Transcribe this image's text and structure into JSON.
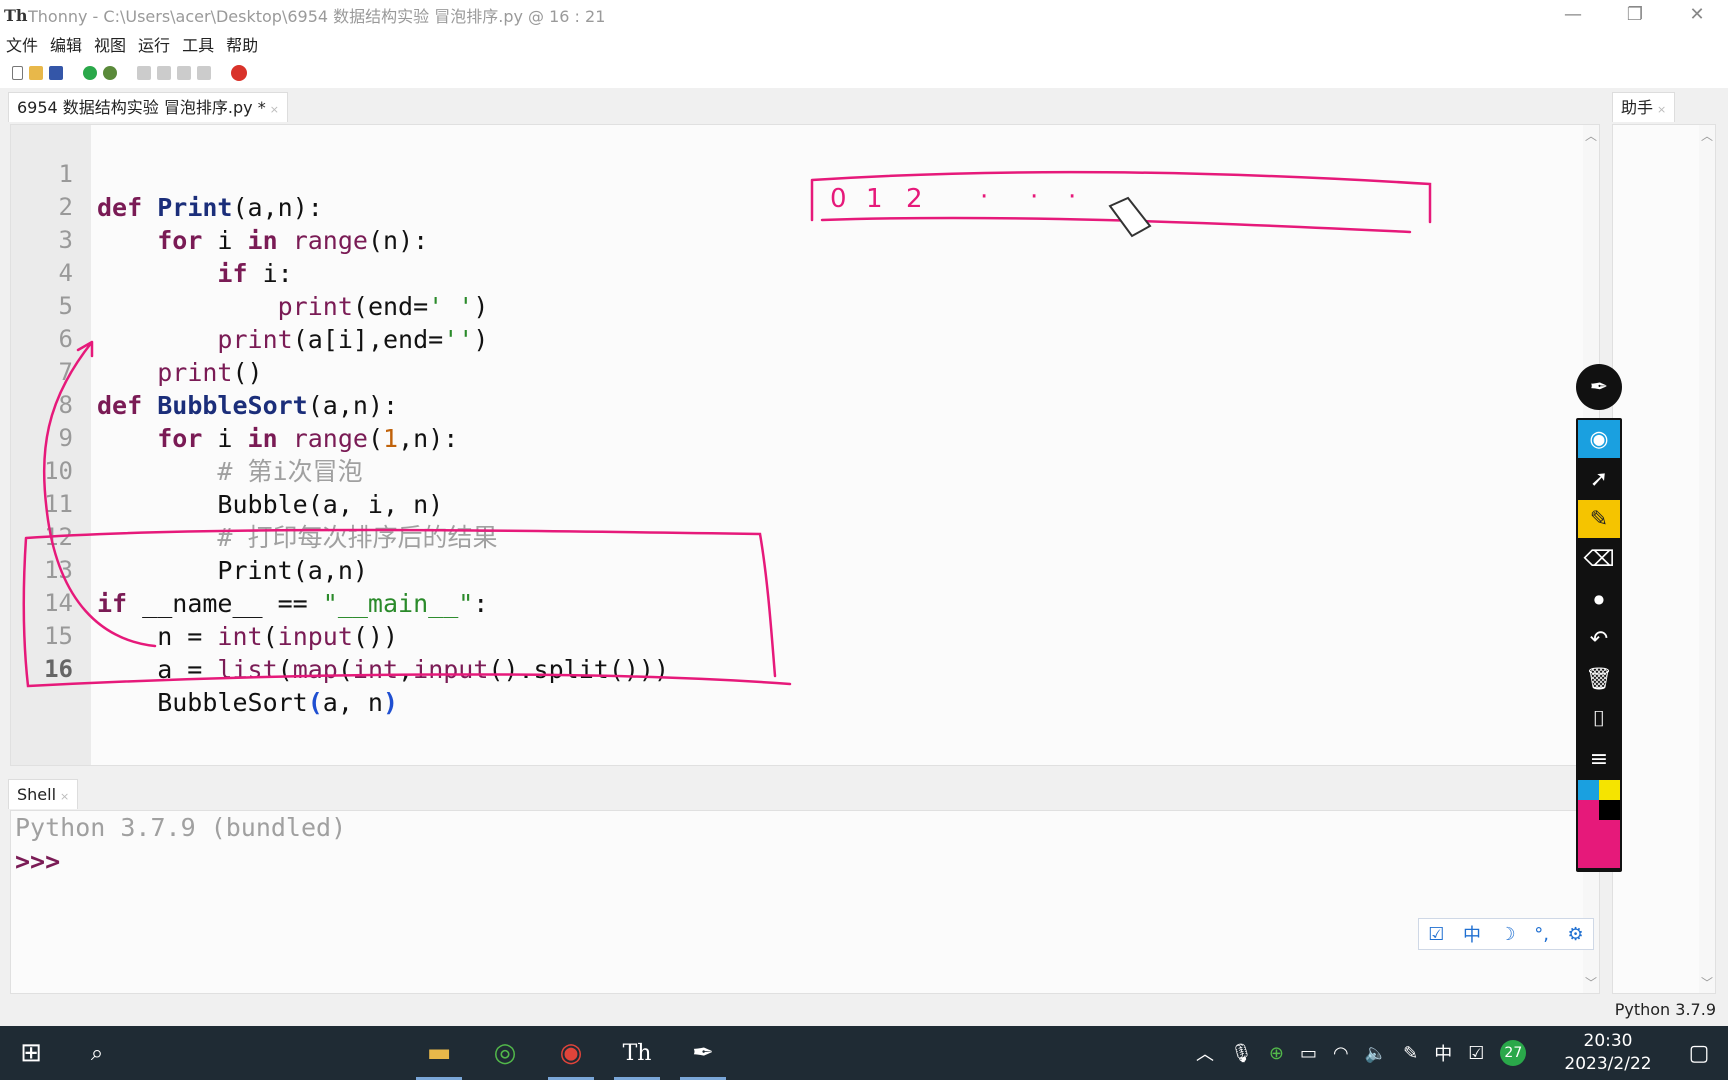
{
  "window": {
    "title": "Thonny  -  C:\\Users\\acer\\Desktop\\6954 数据结构实验 冒泡排序.py  @  16 : 21",
    "logo": "Th",
    "minimize": "—",
    "restore": "❐",
    "close": "✕"
  },
  "menu": [
    "文件",
    "编辑",
    "视图",
    "运行",
    "工具",
    "帮助"
  ],
  "editor_tab": {
    "label": "6954 数据结构实验 冒泡排序.py *",
    "close": "×"
  },
  "assistant_tab": {
    "label": "助手",
    "close": "×"
  },
  "shell_tab": {
    "label": "Shell",
    "close": "×"
  },
  "line_numbers": [
    "1",
    "2",
    "3",
    "4",
    "5",
    "6",
    "7",
    "8",
    "9",
    "10",
    "11",
    "12",
    "13",
    "14",
    "15",
    "16"
  ],
  "shell": {
    "banner": "Python 3.7.9 (bundled)",
    "prompt": ">>>"
  },
  "ime": {
    "mode": "中"
  },
  "annotation_digits": [
    "0",
    "1",
    "2",
    "·",
    "·",
    "·"
  ],
  "status": {
    "version": "Python 3.7.9"
  },
  "clock": {
    "time": "20:30",
    "date": "2023/2/22"
  },
  "tray": {
    "lang": "中",
    "badge": "27"
  },
  "colors": {
    "ink": "#e6197a",
    "keyword": "#7a1b55",
    "function": "#1b2e7a",
    "string": "#2a8a2a",
    "comment": "#a0a0a0",
    "taskbar": "#1f2b34"
  }
}
